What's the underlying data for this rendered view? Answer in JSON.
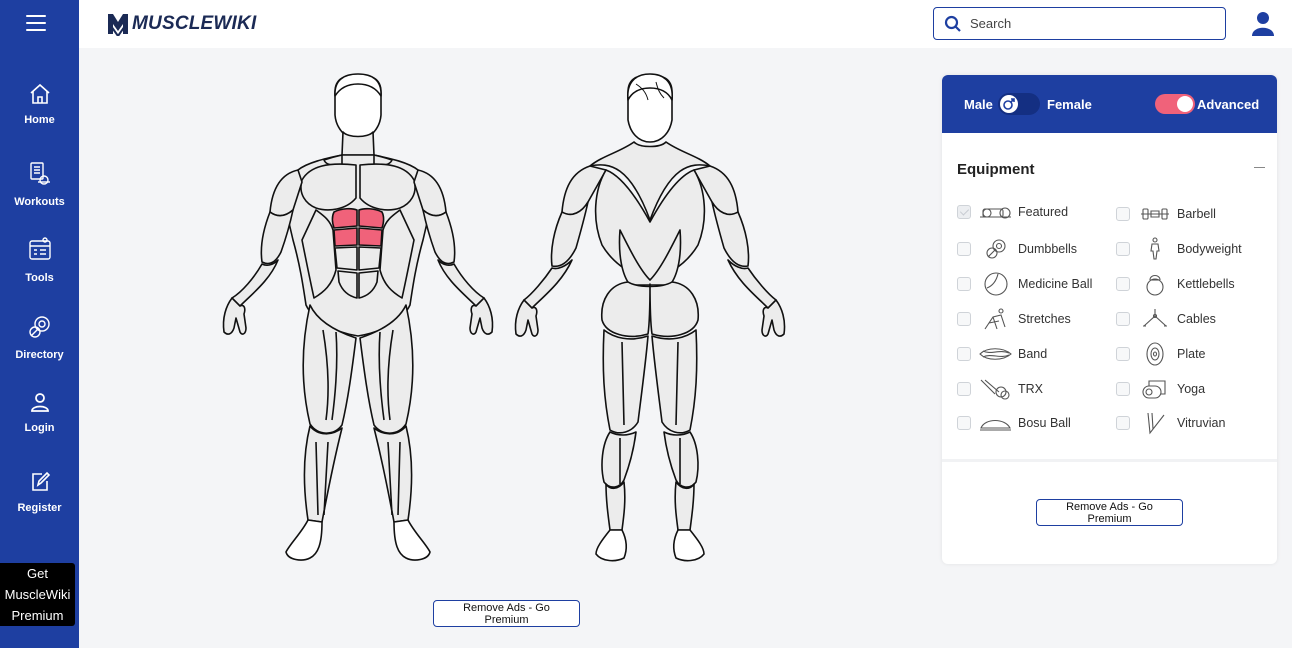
{
  "app": {
    "logo_text": "MUSCLEWIKI"
  },
  "sidebar": {
    "items": [
      {
        "label": "Home",
        "icon": "home-icon"
      },
      {
        "label": "Workouts",
        "icon": "workouts-icon"
      },
      {
        "label": "Tools",
        "icon": "tools-icon"
      },
      {
        "label": "Directory",
        "icon": "directory-icon"
      },
      {
        "label": "Login",
        "icon": "login-icon"
      },
      {
        "label": "Register",
        "icon": "register-icon"
      }
    ],
    "premium_box": {
      "line1": "Get",
      "line2": "MuscleWiki",
      "line3": "Premium"
    }
  },
  "header": {
    "search_placeholder": "Search"
  },
  "main": {
    "premium_button": "Remove Ads - Go Premium",
    "highlighted_muscle": "abdominals",
    "highlight_color": "#f0627a"
  },
  "panel": {
    "male_label": "Male",
    "female_label": "Female",
    "advanced_label": "Advanced",
    "advanced_on": true,
    "equipment_title": "Equipment",
    "equipment": [
      {
        "label": "Featured",
        "checked": true
      },
      {
        "label": "Barbell",
        "checked": false
      },
      {
        "label": "Dumbbells",
        "checked": false
      },
      {
        "label": "Bodyweight",
        "checked": false
      },
      {
        "label": "Medicine Ball",
        "checked": false
      },
      {
        "label": "Kettlebells",
        "checked": false
      },
      {
        "label": "Stretches",
        "checked": false
      },
      {
        "label": "Cables",
        "checked": false
      },
      {
        "label": "Band",
        "checked": false
      },
      {
        "label": "Plate",
        "checked": false
      },
      {
        "label": "TRX",
        "checked": false
      },
      {
        "label": "Yoga",
        "checked": false
      },
      {
        "label": "Bosu Ball",
        "checked": false
      },
      {
        "label": "Vitruvian",
        "checked": false
      }
    ],
    "premium_button": "Remove Ads - Go Premium"
  },
  "colors": {
    "brand_blue": "#1e3fa1",
    "accent_pink": "#f0627a"
  }
}
